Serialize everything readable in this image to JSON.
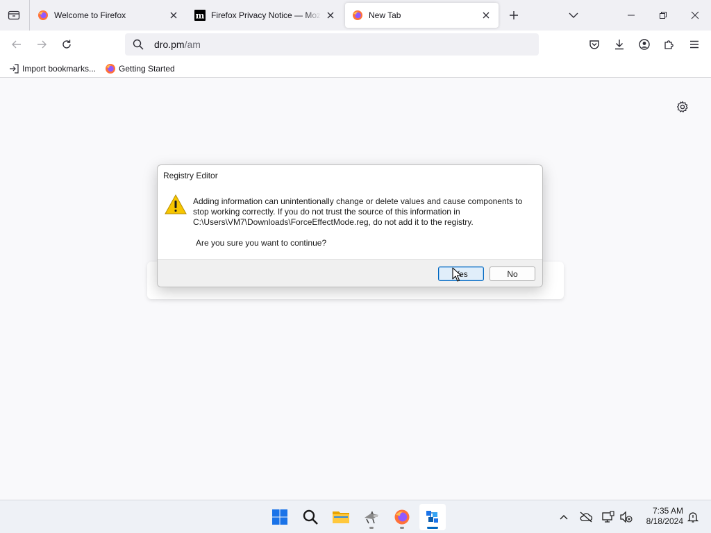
{
  "browser": {
    "tabs": [
      {
        "label": "Welcome to Firefox",
        "favicon": "firefox-icon"
      },
      {
        "label": "Firefox Privacy Notice — Mozilla",
        "favicon": "mozilla-m-icon"
      },
      {
        "label": "New Tab",
        "favicon": "firefox-icon",
        "active": true
      }
    ],
    "url": {
      "host": "dro.pm",
      "path": "/am"
    },
    "bookmarks": [
      {
        "label": "Import bookmarks...",
        "icon": "import-icon"
      },
      {
        "label": "Getting Started",
        "icon": "firefox-icon"
      }
    ]
  },
  "dialog": {
    "title": "Registry Editor",
    "message": "Adding information can unintentionally change or delete values and cause components to stop working correctly. If you do not trust the source of this information in C:\\Users\\VM7\\Downloads\\ForceEffectMode.reg, do not add it to the registry.",
    "question": "Are you sure you want to continue?",
    "yes_label": "Yes",
    "no_label": "No",
    "icon": "warning-icon"
  },
  "taskbar": {
    "apps": [
      "windows-start-icon",
      "search-icon",
      "file-explorer-icon",
      "app-icon",
      "firefox-icon",
      "registry-editor-icon"
    ],
    "time": "7:35 AM",
    "date": "8/18/2024"
  },
  "colors": {
    "accent": "#0067c0",
    "warning": "#f7c600",
    "firefox_orange": "#ff7139",
    "firefox_purple": "#9059ff"
  }
}
